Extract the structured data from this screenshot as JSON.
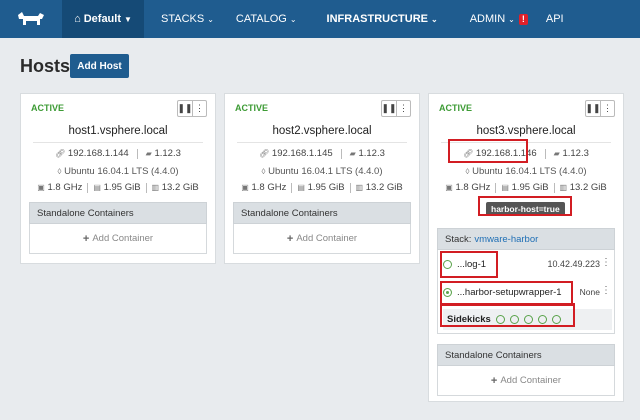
{
  "nav": {
    "environment": "Default",
    "items": [
      {
        "label": "STACKS",
        "bold": false
      },
      {
        "label": "CATALOG",
        "bold": false
      },
      {
        "label": "INFRASTRUCTURE",
        "bold": true
      },
      {
        "label": "ADMIN",
        "bold": false
      },
      {
        "label": "API",
        "bold": false
      }
    ],
    "admin_alert": "!"
  },
  "page": {
    "title": "Hosts",
    "add_host_label": "Add Host"
  },
  "hosts": [
    {
      "state": "ACTIVE",
      "name": "host1.vsphere.local",
      "ip": "192.168.1.144",
      "docker_version": "1.12.3",
      "os": "Ubuntu 16.04.1 LTS (4.4.0)",
      "cpu": "1.8 GHz",
      "memory": "1.95 GiB",
      "storage": "13.2 GiB",
      "standalone_title": "Standalone Containers",
      "add_container_label": "Add Container"
    },
    {
      "state": "ACTIVE",
      "name": "host2.vsphere.local",
      "ip": "192.168.1.145",
      "docker_version": "1.12.3",
      "os": "Ubuntu 16.04.1 LTS (4.4.0)",
      "cpu": "1.8 GHz",
      "memory": "1.95 GiB",
      "storage": "13.2 GiB",
      "standalone_title": "Standalone Containers",
      "add_container_label": "Add Container"
    },
    {
      "state": "ACTIVE",
      "name": "host3.vsphere.local",
      "ip": "192.168.1.146",
      "docker_version": "1.12.3",
      "os": "Ubuntu 16.04.1 LTS (4.4.0)",
      "cpu": "1.8 GHz",
      "memory": "1.95 GiB",
      "storage": "13.2 GiB",
      "label": "harbor-host=true",
      "stack": {
        "prefix": "Stack:",
        "name": "vmware-harbor",
        "services": [
          {
            "name": "...log-1",
            "detail": "10.42.49.223"
          },
          {
            "name": "...harbor-setupwrapper-1",
            "detail": "None"
          }
        ],
        "sidekicks_label": "Sidekicks"
      },
      "standalone_title": "Standalone Containers",
      "add_container_label": "Add Container"
    }
  ],
  "colors": {
    "nav_bg": "#1f5c8f",
    "active_green": "#3d9b35",
    "highlight_red": "#d21d23"
  }
}
